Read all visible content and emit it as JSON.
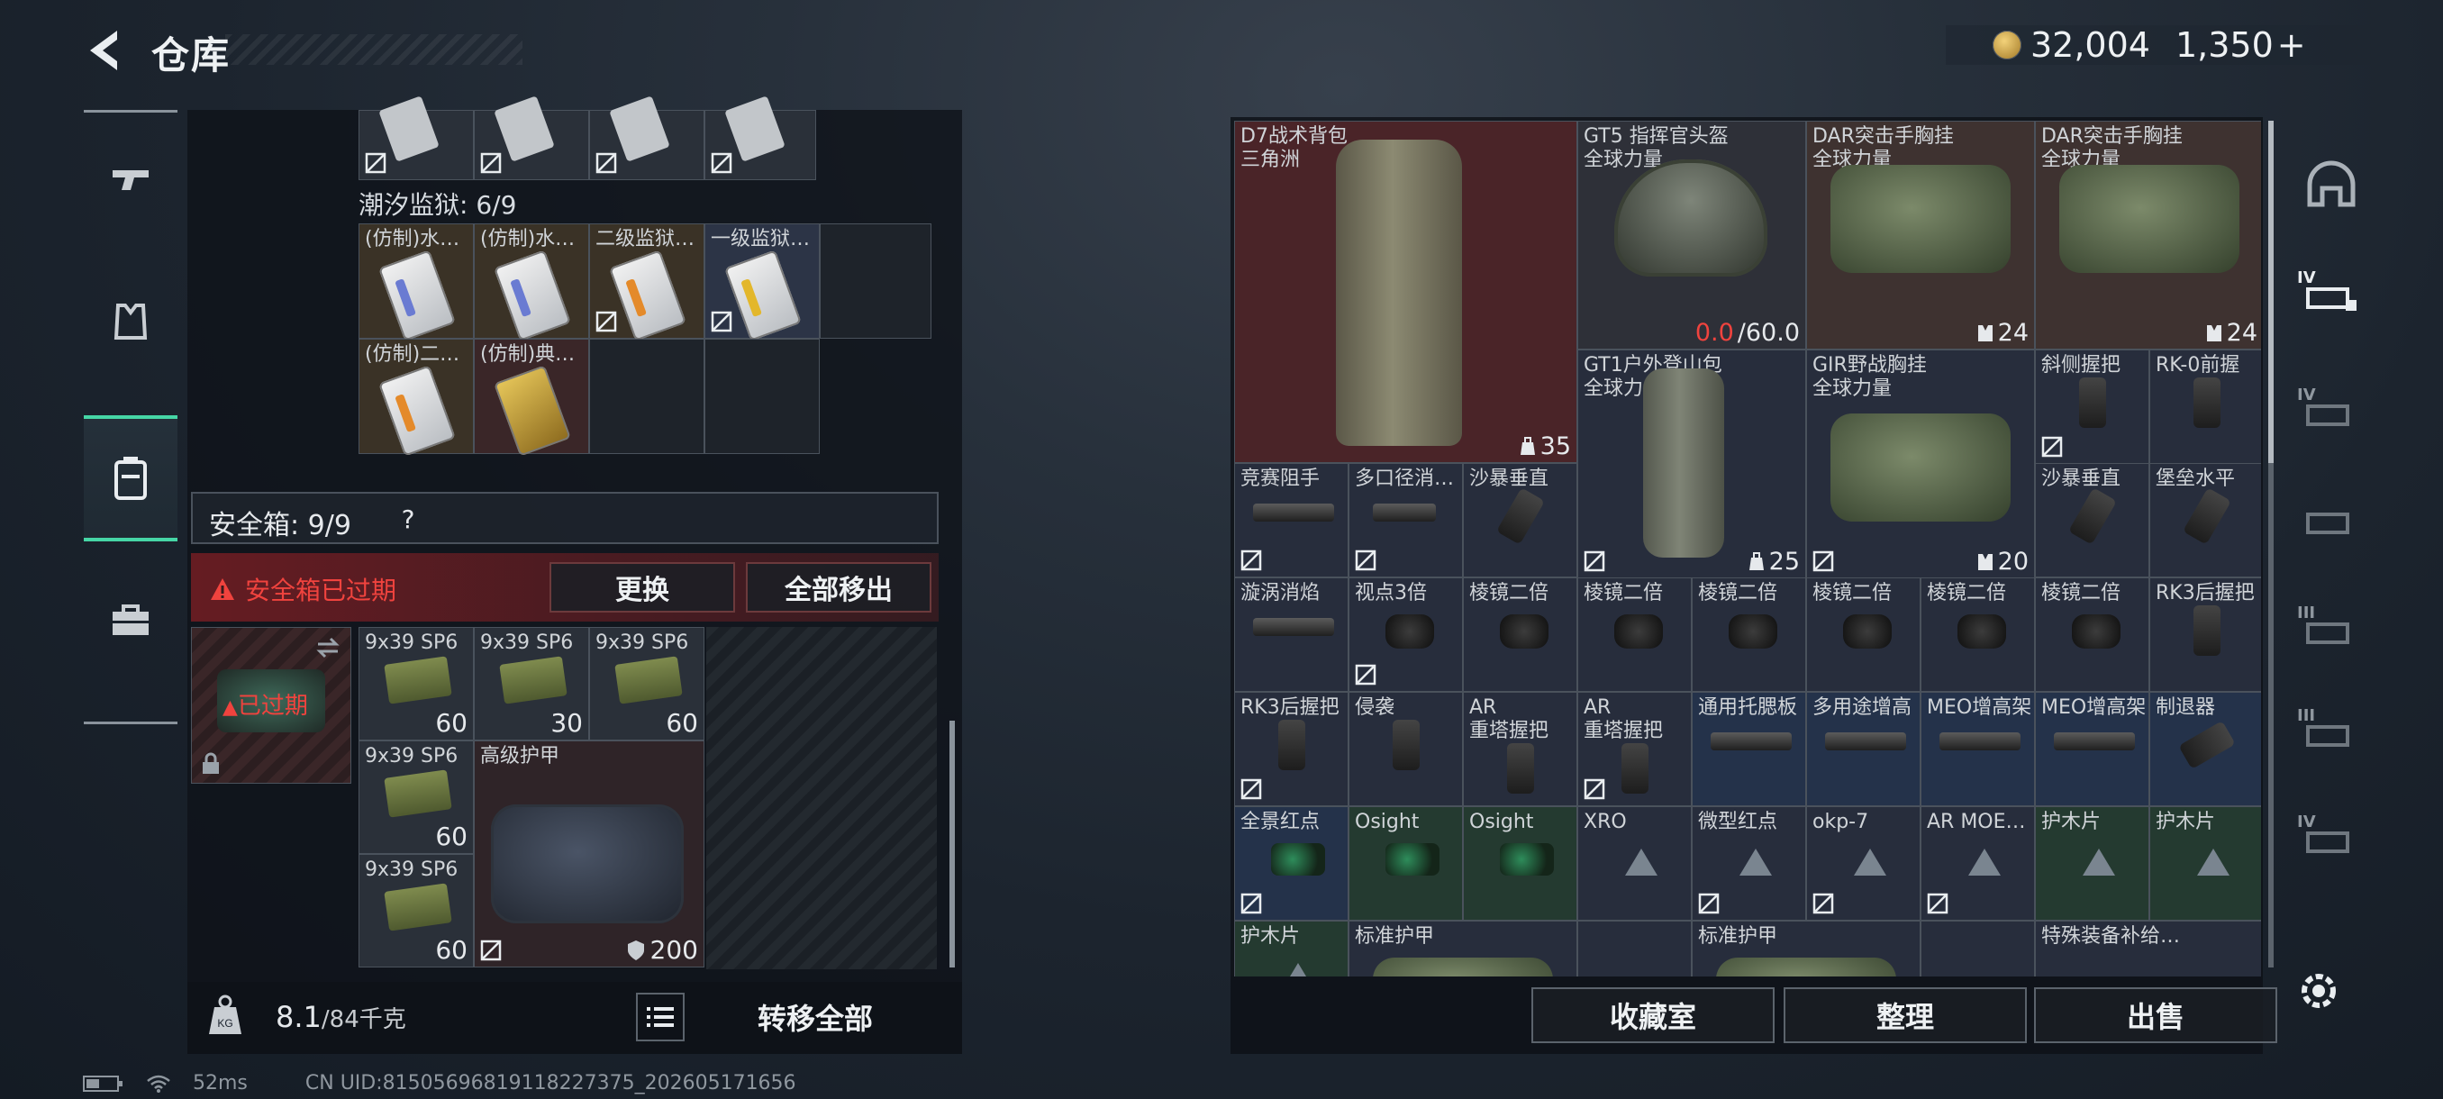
{
  "header": {
    "title": "仓库",
    "silver": "32,004",
    "gold": "1,350",
    "gold_plus": "+"
  },
  "left_stash": {
    "top_row_count": 4,
    "tide_label": "潮汐监狱: 6/9",
    "keycards": [
      {
        "label": "(仿制)水…"
      },
      {
        "label": "(仿制)水…"
      },
      {
        "label": "二级监狱…"
      },
      {
        "label": "一级监狱…"
      },
      {
        "label": "(仿制)二…"
      },
      {
        "label": "(仿制)典…"
      }
    ]
  },
  "safe_box": {
    "label": "安全箱: 9/9",
    "help": "?",
    "expired_text": "安全箱已过期",
    "replace": "更换",
    "move_all": "全部移出",
    "expired_tag": "已过期",
    "ammo": [
      {
        "label": "9x39 SP6",
        "count": "60"
      },
      {
        "label": "9x39 SP6",
        "count": "30"
      },
      {
        "label": "9x39 SP6",
        "count": "60"
      },
      {
        "label": "9x39 SP6",
        "count": "60"
      },
      {
        "label": "9x39 SP6",
        "count": "60"
      }
    ],
    "armor": {
      "label": "高级护甲",
      "count": "200"
    }
  },
  "bottom_left": {
    "weight": "8.1",
    "weight_cap": "/84千克",
    "transfer": "转移全部"
  },
  "status": {
    "ping": "52ms",
    "uid": "CN UID:8150569681911822737​5_202605171656"
  },
  "right_grid": {
    "backpack": {
      "name": "D7战术背包",
      "sub": "三角洲",
      "count": "35"
    },
    "helmet": {
      "name": "GT5 指挥官头盔",
      "sub": "全球力量",
      "dur_cur": "0.0",
      "dur_max": "/60.0"
    },
    "rig1": {
      "name": "DAR突击手胸挂",
      "sub": "全球力量",
      "count": "24"
    },
    "rig2": {
      "name": "DAR突击手胸挂",
      "sub": "全球力量",
      "count": "24"
    },
    "bag2": {
      "name": "GT1户外登山包",
      "sub": "全球力量",
      "count": "25"
    },
    "rig3": {
      "name": "GIR野战胸挂",
      "sub": "全球力量",
      "count": "20"
    },
    "r3": [
      "斜侧握把",
      "RK-0前握"
    ],
    "r4a": [
      "竞赛阻手",
      "多口径消…",
      "沙暴垂直"
    ],
    "r4b": [
      "沙暴垂直",
      "堡垒水平"
    ],
    "r5": [
      "漩涡消焰",
      "视点3倍",
      "棱镜二倍",
      "棱镜二倍",
      "棱镜二倍",
      "棱镜二倍",
      "棱镜二倍",
      "棱镜二倍",
      "RK3后握把"
    ],
    "r6": [
      "RK3后握把",
      "侵袭",
      "AR",
      "AR",
      "通用托腮板",
      "多用途增高",
      "MEO增高架",
      "MEO增高架",
      "制退器"
    ],
    "r6_sub": [
      "重塔握把",
      "重塔握把"
    ],
    "r7": [
      "全景红点",
      "Osight",
      "Osight",
      "XRO",
      "微型红点",
      "okp-7",
      "AR MOE…",
      "护木片",
      "护木片"
    ],
    "r8": [
      "护木片",
      "标准护甲",
      "标准护甲",
      "特殊装备补给…"
    ]
  },
  "bottom_right": {
    "collection": "收藏室",
    "sort": "整理",
    "sell": "出售"
  },
  "rail_labels": [
    "IV",
    "IV",
    "III",
    "III",
    "IV"
  ]
}
